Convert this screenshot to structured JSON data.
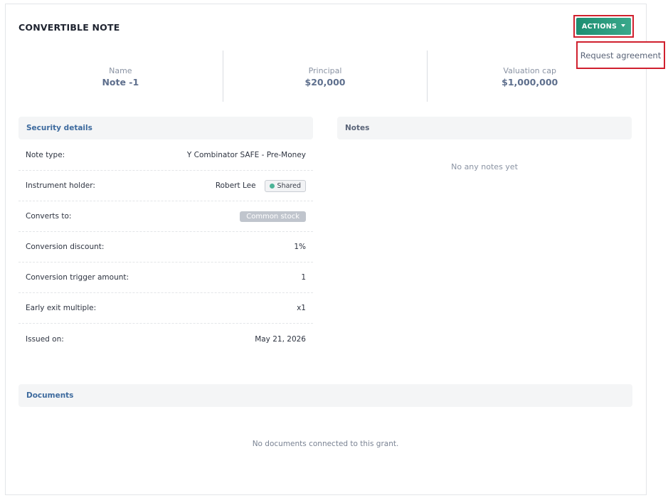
{
  "page": {
    "title": "CONVERTIBLE NOTE"
  },
  "actions": {
    "button_label": "ACTIONS",
    "menu_items": [
      "Request agreement"
    ]
  },
  "summary": [
    {
      "label": "Name",
      "value": "Note -1"
    },
    {
      "label": "Principal",
      "value": "$20,000"
    },
    {
      "label": "Valuation cap",
      "value": "$1,000,000"
    }
  ],
  "security_details": {
    "title": "Security details",
    "rows": [
      {
        "label": "Note type:",
        "value": "Y Combinator SAFE - Pre-Money"
      },
      {
        "label": "Instrument holder:",
        "value": "Robert Lee",
        "badge": "Shared"
      },
      {
        "label": "Converts to:",
        "value": "Common stock"
      },
      {
        "label": "Conversion discount:",
        "value": "1%"
      },
      {
        "label": "Conversion trigger amount:",
        "value": "1"
      },
      {
        "label": "Early exit multiple:",
        "value": "x1"
      },
      {
        "label": "Issued on:",
        "value": "May 21, 2026"
      }
    ]
  },
  "notes": {
    "title": "Notes",
    "empty_text": "No any notes yet"
  },
  "documents": {
    "title": "Documents",
    "empty_text": "No documents connected to this grant."
  },
  "colors": {
    "accent": "#1e8e72",
    "highlight": "#d0202e",
    "link": "#3d6a9e",
    "shared_dot": "#4cb397"
  }
}
